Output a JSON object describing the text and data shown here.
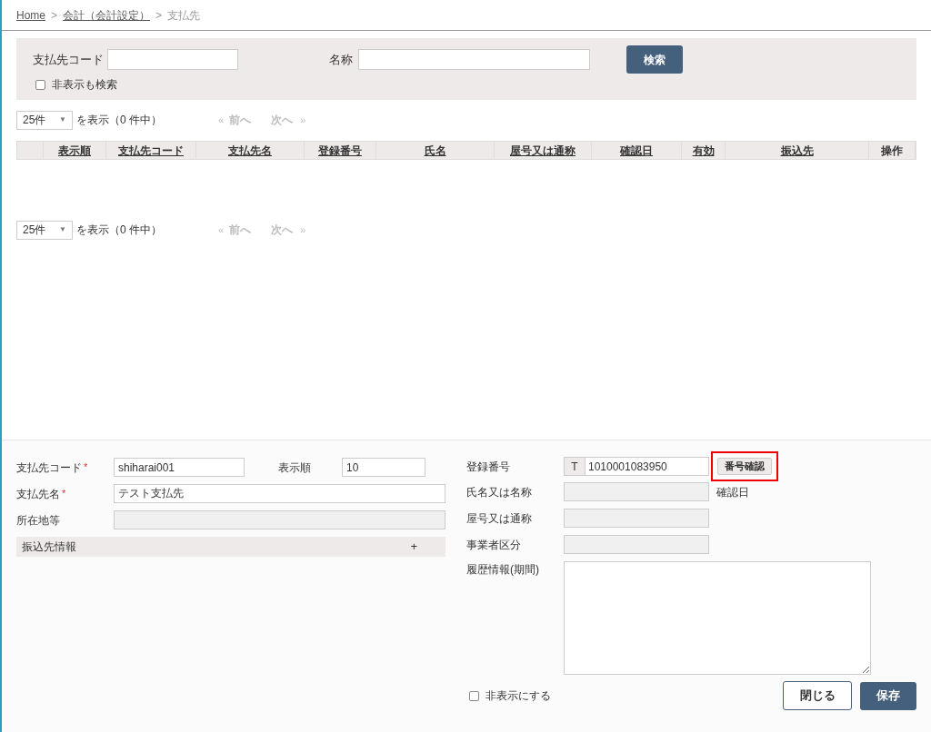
{
  "breadcrumb": [
    {
      "label": "Home",
      "link": true
    },
    {
      "separator": ">",
      "label": "会計（会計設定）",
      "link": true
    },
    {
      "separator": ">",
      "label": "支払先",
      "link": false
    }
  ],
  "search": {
    "code_label": "支払先コード",
    "name_label": "名称",
    "button": "検索",
    "include_hidden": {
      "label": "非表示も検索",
      "checked": false
    }
  },
  "pagers": [
    {
      "page_size": "25件",
      "caret": "▼",
      "shown": "を表示（0 件中）",
      "prev_mark": "«",
      "prev": "前へ",
      "next": "次へ",
      "next_mark": "»"
    },
    {
      "page_size": "25件",
      "caret": "▼",
      "shown": "を表示（0 件中）",
      "prev_mark": "«",
      "prev": "前へ",
      "next": "次へ",
      "next_mark": "»"
    }
  ],
  "table": {
    "columns": [
      {
        "label": "表示順",
        "sortable": true
      },
      {
        "label": "支払先コード",
        "sortable": true
      },
      {
        "label": "支払先名",
        "sortable": true
      },
      {
        "label": "登録番号",
        "sortable": true
      },
      {
        "label": "氏名",
        "sortable": true
      },
      {
        "label": "屋号又は通称",
        "sortable": true
      },
      {
        "label": "確認日",
        "sortable": true
      },
      {
        "label": "有効",
        "sortable": true
      },
      {
        "label": "振込先",
        "sortable": true
      },
      {
        "label": "操作",
        "sortable": false
      }
    ]
  },
  "form": {
    "code": {
      "label": "支払先コード",
      "required_mark": "*",
      "value": "shiharai001"
    },
    "order": {
      "label": "表示順",
      "value": "10"
    },
    "name": {
      "label": "支払先名",
      "required_mark": "*",
      "value": "テスト支払先"
    },
    "address": {
      "label": "所在地等"
    },
    "bank_section": {
      "label": "振込先情報",
      "toggle": "+"
    },
    "reg_no": {
      "label": "登録番号",
      "prefix": "T",
      "value": "1010001083950",
      "button": "番号確認",
      "highlighted": true
    },
    "person": {
      "label": "氏名又は名称",
      "date_label": "確認日"
    },
    "trade_name": {
      "label": "屋号又は通称"
    },
    "business_type": {
      "label": "事業者区分"
    },
    "history": {
      "label": "履歴情報(期間)"
    },
    "hide": {
      "label": "非表示にする",
      "checked": false
    },
    "close": "閉じる",
    "save": "保存"
  }
}
